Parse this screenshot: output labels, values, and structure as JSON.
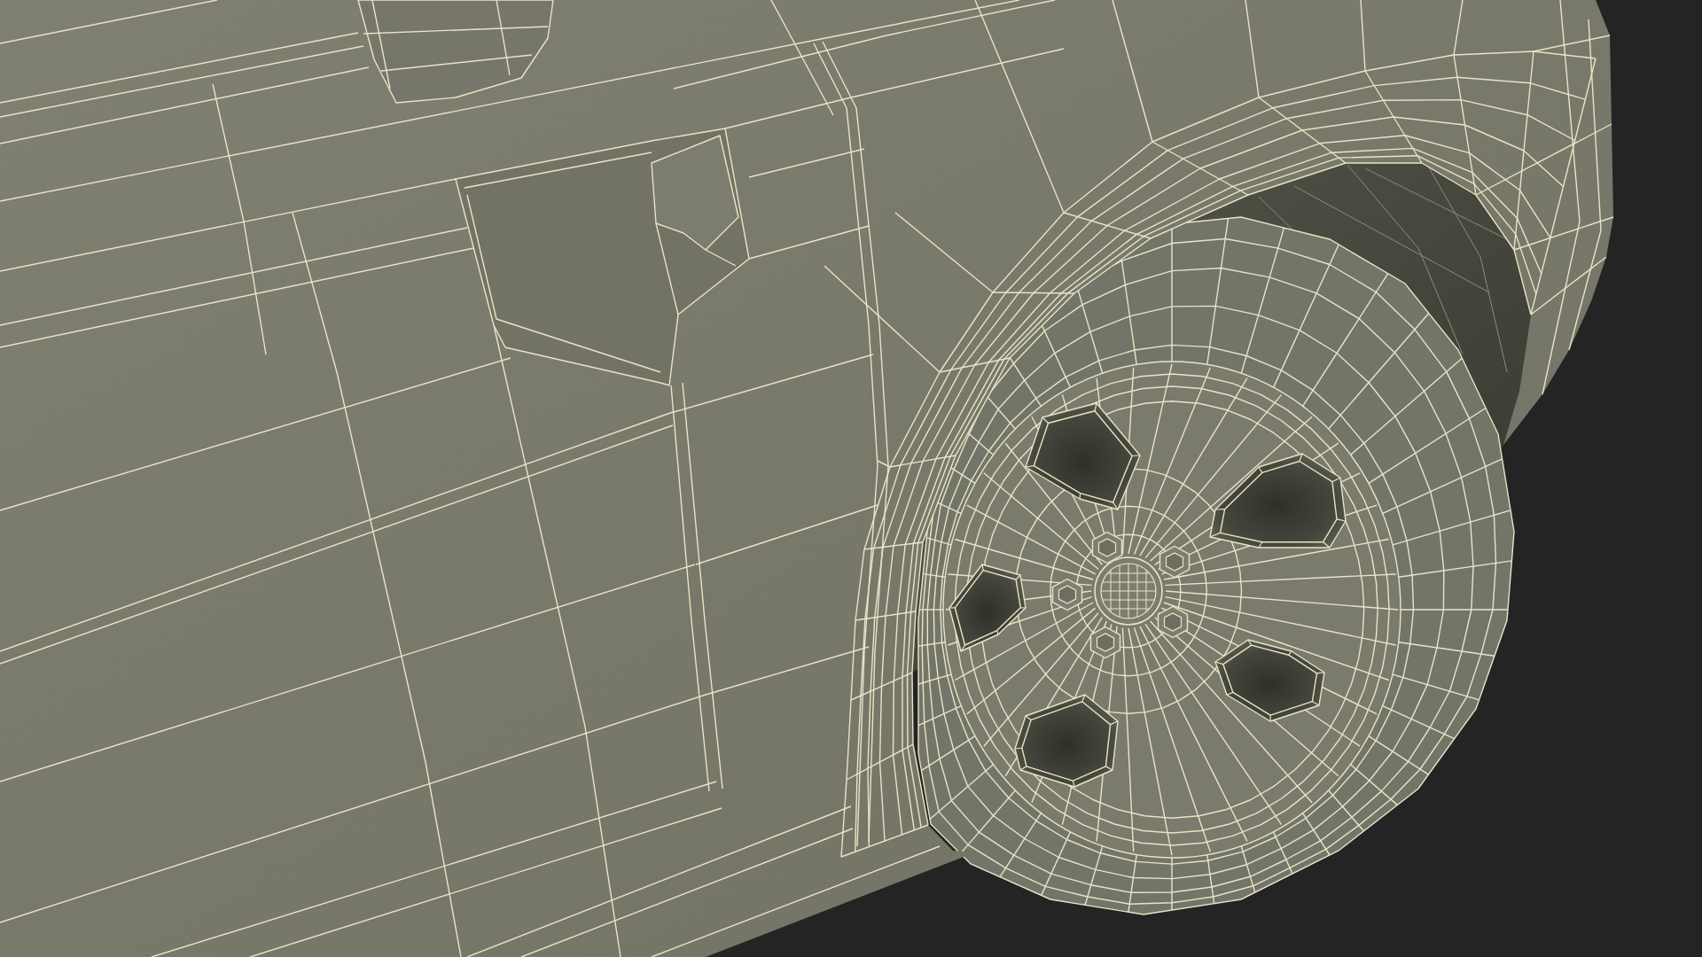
{
  "render": {
    "kind": "wireframe"
  }
}
